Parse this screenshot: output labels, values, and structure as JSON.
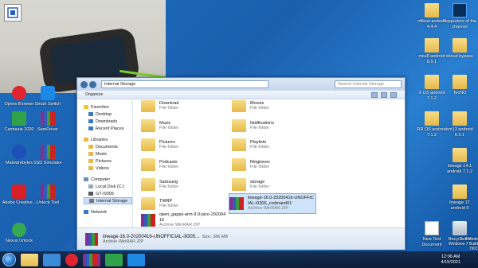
{
  "desktop_icons": [
    {
      "label": "Opera Browser"
    },
    {
      "label": "Smart Switch"
    },
    {
      "label": "Camtasia 2020"
    },
    {
      "label": "SamDriver"
    },
    {
      "label": "Malwarebytes"
    },
    {
      "label": "SSD Simulator"
    },
    {
      "label": "Adobe Creative..."
    },
    {
      "label": "Unlock Tool"
    },
    {
      "label": "Nexus Unlock"
    },
    {
      "label": "official android 4.4.4"
    },
    {
      "label": "Supporters of the channel"
    },
    {
      "label": "miui8 android 8.0.1"
    },
    {
      "label": "icloud bypass"
    },
    {
      "label": "X OS android 7.1.2"
    },
    {
      "label": "TecNO"
    },
    {
      "label": "RR OS android 7.1.2"
    },
    {
      "label": "cm13 android 6.0.1"
    },
    {
      "label": "lineage 14.1 android 7.1.2"
    },
    {
      "label": "lineage 17 android 9"
    },
    {
      "label": "New Text Document"
    },
    {
      "label": "Recycle Bin"
    }
  ],
  "explorer": {
    "breadcrumb": "Internal Storage",
    "search_placeholder": "Search Internal Storage",
    "toolbar": {
      "organize": "Organize"
    },
    "nav": {
      "favorites": "Favorites",
      "favorites_items": [
        "Desktop",
        "Downloads",
        "Recent Places"
      ],
      "libraries": "Libraries",
      "libraries_items": [
        "Documents",
        "Music",
        "Pictures",
        "Videos"
      ],
      "computer": "Computer",
      "computer_items": [
        "Local Disk (C:)",
        "GT-I9305",
        "Internal Storage"
      ],
      "network": "Network"
    },
    "files": [
      {
        "name": "Download",
        "type": "File folder"
      },
      {
        "name": "Movies",
        "type": "File folder"
      },
      {
        "name": "Music",
        "type": "File folder"
      },
      {
        "name": "Notifications",
        "type": "File folder"
      },
      {
        "name": "Pictures",
        "type": "File folder"
      },
      {
        "name": "Playlists",
        "type": "File folder"
      },
      {
        "name": "Podcasts",
        "type": "File folder"
      },
      {
        "name": "Ringtones",
        "type": "File folder"
      },
      {
        "name": "Samsung",
        "type": "File folder"
      },
      {
        "name": "storage",
        "type": "File folder"
      },
      {
        "name": "TWRP",
        "type": "File folder"
      },
      {
        "name": "lineage-16.0-20200416-UNOFFICIAL-i9305_codmand01",
        "type": "Archive WinRAR ZIP"
      },
      {
        "name": "open_gapps-arm-9.0-pico-20200416",
        "type": "Archive WinRAR ZIP"
      }
    ],
    "details": {
      "name": "lineage-16.0-20200416-UNOFFICIAL-i9305...",
      "type": "Archive WinRAR ZIP",
      "size": "Size: 386 MB"
    }
  },
  "taskbar": {
    "time": "12:06 AM",
    "date": "4/15/2021",
    "watermark": "Test Mode Windows 7 Build 7601"
  }
}
